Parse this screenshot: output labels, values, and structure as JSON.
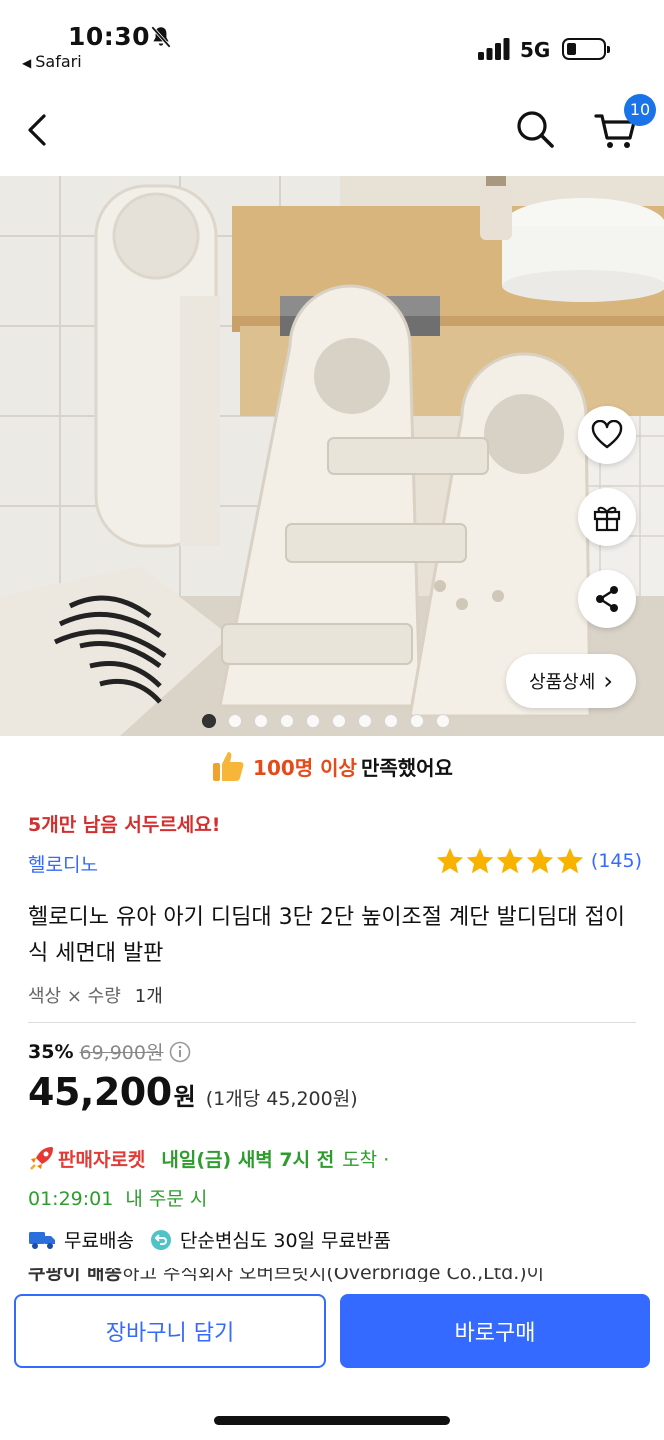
{
  "status_bar": {
    "time": "10:30",
    "back_app": "Safari",
    "network": "5G",
    "icons": [
      "bell-muted-icon",
      "signal-icon",
      "battery-icon"
    ]
  },
  "nav": {
    "icons": [
      "back-chevron-icon",
      "search-icon",
      "cart-icon"
    ],
    "cart_count": "10"
  },
  "hero": {
    "image_count": 10,
    "active_index": 0,
    "actions": [
      "heart-icon",
      "gift-icon",
      "share-icon"
    ],
    "detail_label": "상품상세",
    "detail_chevron": "›"
  },
  "satisfaction": {
    "highlight": "100명 이상",
    "rest": "만족했어요",
    "icon": "thumbs-up-icon"
  },
  "stock_notice": "5개만 남음 서두르세요!",
  "brand": "헬로디노",
  "rating": {
    "stars": 5,
    "count": "(145)"
  },
  "product_title": "헬로디노 유아 아기 디딤대 3단 2단 높이조절 계단 발디딤대 접이식 세면대 발판",
  "option": {
    "label": "색상 × 수량",
    "qty": "1개"
  },
  "pricing": {
    "discount": "35%",
    "original": "69,900원",
    "price": "45,200",
    "currency": "원",
    "unit_price": "(1개당 45,200원)"
  },
  "shipping": {
    "rocket_label": "판매자로켓",
    "arrival": "내일(금) 새벽 7시 전",
    "arrival_tail": "도착 ·",
    "countdown": "01:29:01",
    "countdown_tail": "내 주문 시",
    "free_shipping": "무료배송",
    "free_return": "단순변심도 30일 무료반품",
    "partial_bold": "쿠팡이 배송",
    "partial_rest": "하고 주식회사 오버브릿지(Overbridge Co.,Ltd.)이"
  },
  "buttons": {
    "add_to_cart": "장바구니 담기",
    "buy_now": "바로구매"
  },
  "colors": {
    "accent": "#346aff",
    "badge": "#1a73e8",
    "alert": "#d32f2f",
    "green": "#2e9d2e",
    "orange": "#e64a19"
  }
}
